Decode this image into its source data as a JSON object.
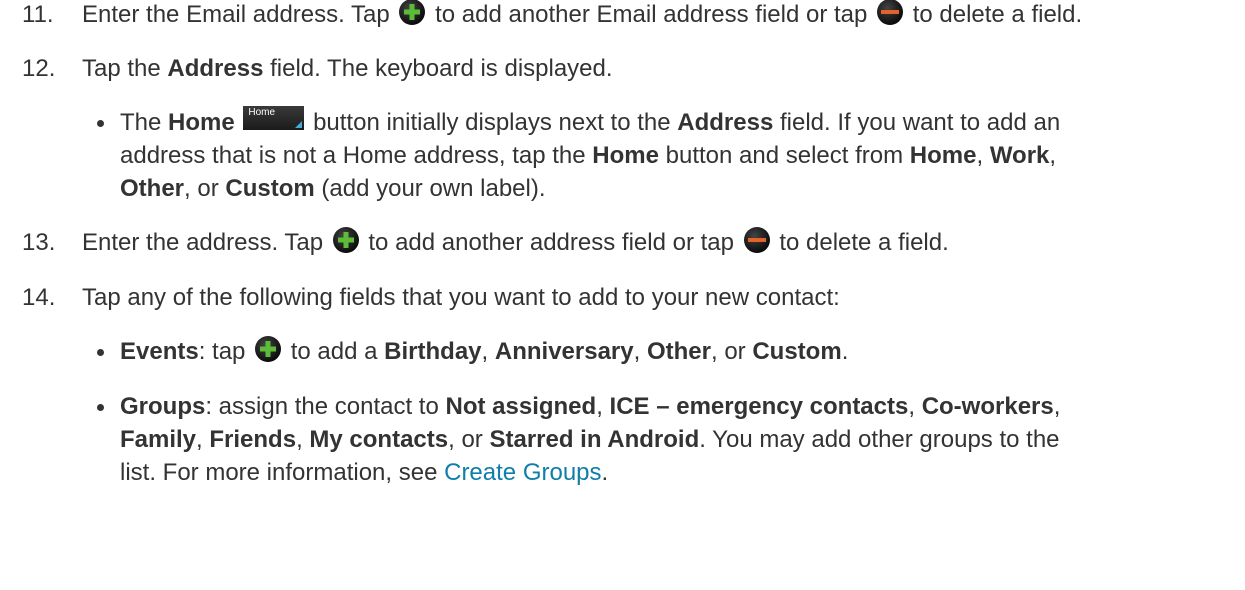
{
  "steps": {
    "s11": {
      "num": "11.",
      "t1": "Enter the Email address. Tap",
      "t2": "to add another Email address field or tap",
      "t3": "to delete a field."
    },
    "s12": {
      "num": "12.",
      "t1": "Tap the",
      "b1": "Address",
      "t2": "field. The keyboard is displayed."
    },
    "s13": {
      "num": "13.",
      "t1": "Enter the address. Tap",
      "t2": "to add another address field or tap",
      "t3": "to delete a field."
    },
    "s14": {
      "num": "14.",
      "t1": "Tap any of the following fields that you want to add to your new contact:"
    }
  },
  "bullet_home": {
    "t1": "The",
    "b1": "Home",
    "button_label": "Home",
    "t2": "button initially displays next to the",
    "b2": "Address",
    "t3": "field. If you want to add an",
    "t4": "address that is not a Home address, tap the",
    "b3": "Home",
    "t5": "button and select from",
    "b4": "Home",
    "t6": ",",
    "b5": "Work",
    "t7": ",",
    "b6": "Other",
    "t8": ", or",
    "b7": "Custom",
    "t9": "(add your own label)."
  },
  "bullet_events": {
    "b1": "Events",
    "t1": ": tap",
    "t2": "to add a",
    "b2": "Birthday",
    "t3": ",",
    "b3": "Anniversary",
    "t4": ",",
    "b4": "Other",
    "t5": ", or",
    "b5": "Custom",
    "t6": "."
  },
  "bullet_groups": {
    "b1": "Groups",
    "t1": ": assign the contact to",
    "b2": "Not assigned",
    "t2": ",",
    "b3": "ICE – emergency contacts",
    "t3": ",",
    "b4": "Co-workers",
    "t4": ",",
    "b5": "Family",
    "t5": ",",
    "b6": "Friends",
    "t6": ",",
    "b7": "My contacts",
    "t7": ", or",
    "b8": "Starred in Android",
    "t8": ". You may add other groups to the",
    "t9": "list. For more information, see",
    "link": "Create Groups",
    "t10": "."
  },
  "icons": {
    "add": "plus-circle-icon",
    "remove": "minus-circle-icon",
    "add_color": "#5dbb3a",
    "remove_color": "#e0642a"
  }
}
